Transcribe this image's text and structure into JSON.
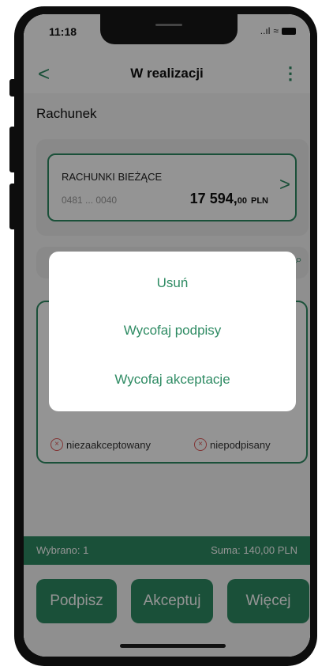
{
  "status": {
    "time": "11:18",
    "signal": "..ıl",
    "wifi": "≈"
  },
  "appbar": {
    "back": "<",
    "title": "W realizacji",
    "menu": "⋮"
  },
  "account_section": {
    "label": "Rachunek"
  },
  "account": {
    "name": "RACHUNKI BIEŻĄCE",
    "number": "0481 ... 0040",
    "amount_main": "17 594,",
    "amount_dec": "00",
    "currency": "PLN",
    "chevron": ">"
  },
  "search": {
    "icon": "⌕"
  },
  "item": {
    "status_accept": "niezaakceptowany",
    "status_sign": "niepodpisany",
    "x_icon": "×"
  },
  "summary": {
    "selected": "Wybrano: 1",
    "total": "Suma: 140,00 PLN"
  },
  "actions": {
    "sign": "Podpisz",
    "accept": "Akceptuj",
    "more": "Więcej"
  },
  "modal": {
    "delete": "Usuń",
    "withdraw_signatures": "Wycofaj podpisy",
    "withdraw_acceptance": "Wycofaj akceptacje"
  },
  "colors": {
    "accent": "#2e8b63",
    "error": "#e05a5a"
  }
}
